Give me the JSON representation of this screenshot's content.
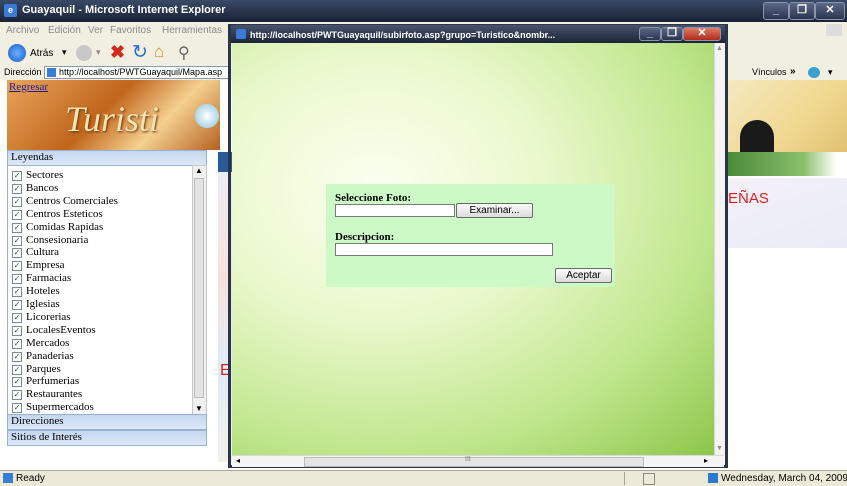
{
  "browser": {
    "title": "Guayaquil - Microsoft Internet Explorer",
    "menu": [
      "Archivo",
      "Edición",
      "Ver",
      "Favoritos",
      "Herramientas"
    ],
    "back_label": "Atrás",
    "address_label": "Dirección",
    "address_url": "http://localhost/PWTGuayaquil/Mapa.asp",
    "links_label": "Vínculos"
  },
  "page": {
    "regresar": "Regresar",
    "banner_text": "Turisti",
    "leyendas_title": "Leyendas",
    "leyendas": [
      "Sectores",
      "Bancos",
      "Centros Comerciales",
      "Centros Esteticos",
      "Comidas Rapidas",
      "Consesionaria",
      "Cultura",
      "Empresa",
      "Farmacias",
      "Hoteles",
      "Iglesias",
      "Licorerias",
      "LocalesEventos",
      "Mercados",
      "Panaderias",
      "Parques",
      "Perfumerias",
      "Restaurantes",
      "Supermercados"
    ],
    "direcciones": "Direcciones",
    "sitios": "Sitios de Interés",
    "map_label_right": "EÑAS",
    "map_label_left": "E"
  },
  "popup": {
    "title": "http://localhost/PWTGuayaquil/subirfoto.asp?grupo=Turistico&nombr...",
    "seleccione_label": "Seleccione Foto:",
    "examinar_button": "Examinar...",
    "descripcion_label": "Descripcion:",
    "aceptar_button": "Aceptar",
    "hscroll_mark": "III"
  },
  "status": {
    "text": "Ready",
    "date": "Wednesday, March 04, 2009"
  },
  "colors": {
    "form_background": "#cdf9c7",
    "popup_gradient": "#8cc64a"
  }
}
